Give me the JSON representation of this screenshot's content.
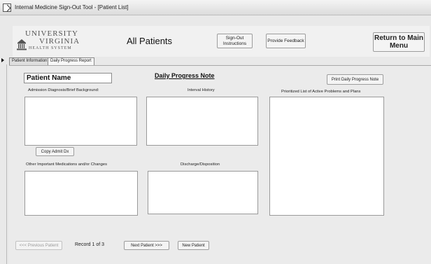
{
  "window": {
    "title": "Internal Medicine Sign-Out Tool - [Patient List]"
  },
  "header": {
    "logo": {
      "line1": "UNIVERSITY",
      "line2": "VIRGINIA",
      "line3": "HEALTH SYSTEM",
      "icon": "rotunda-crest-icon"
    },
    "page_title": "All Patients",
    "signout_label": "Sign-Out Instructions",
    "feedback_label": "Provide Feedback",
    "return_label": "Return to Main Menu"
  },
  "tabs": [
    {
      "label": "Patient Information",
      "active": false
    },
    {
      "label": "Daily Progress Report",
      "active": true
    }
  ],
  "form": {
    "patient_name": "Patient Name",
    "note_title": "Daily Progress Note",
    "print_label": "Print Daily Progress Note",
    "admission_label": "Admission Diagnosis/Brief Background:",
    "interval_label": "Interval History",
    "problems_label": "Prioritized List of Active Problems and Plans",
    "copy_label": "Copy Admit Dx",
    "medications_label": "Other Important Medications and/or Changes",
    "discharge_label": "Discharge/Disposition",
    "fields": {
      "admission": "",
      "interval": "",
      "problems": "",
      "medications": "",
      "discharge": ""
    }
  },
  "footer": {
    "prev_label": "<<< Previous Patient",
    "record_text": "Record 1 of 3",
    "next_label": "Next Patient >>>",
    "new_label": "New Patient"
  },
  "colors": {
    "background": "#e9e9e9",
    "field": "#ffffff",
    "border": "#9a9a9a",
    "disabled_text": "#9a9a9a"
  }
}
